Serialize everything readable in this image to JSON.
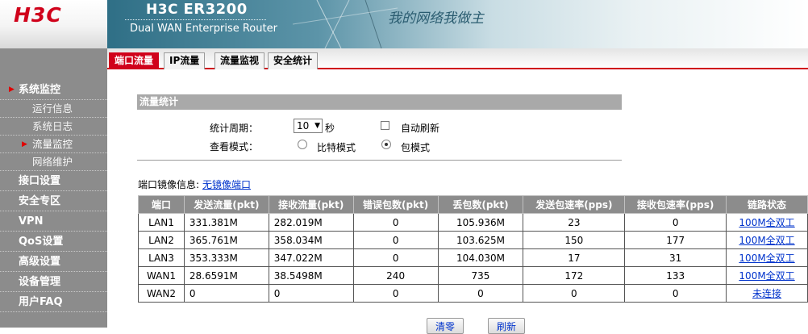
{
  "logo": "H3C",
  "banner": {
    "brand": "H3C",
    "model": "ER3200",
    "subtitle": "Dual WAN Enterprise Router",
    "slogan": "我的网络我做主"
  },
  "tabs": [
    {
      "label": "端口流量",
      "active": true
    },
    {
      "label": "IP流量",
      "active": false
    },
    {
      "label": "流量监视",
      "active": false
    },
    {
      "label": "安全统计",
      "active": false
    }
  ],
  "nav": {
    "groups": [
      {
        "label": "系统监控",
        "open": true,
        "items": [
          {
            "label": "运行信息",
            "active": false
          },
          {
            "label": "系统日志",
            "active": false
          },
          {
            "label": "流量监控",
            "active": true
          },
          {
            "label": "网络维护",
            "active": false
          }
        ]
      },
      {
        "label": "接口设置",
        "open": false,
        "items": []
      },
      {
        "label": "安全专区",
        "open": false,
        "items": []
      },
      {
        "label": "VPN",
        "open": false,
        "items": []
      },
      {
        "label": "QoS设置",
        "open": false,
        "items": []
      },
      {
        "label": "高级设置",
        "open": false,
        "items": []
      },
      {
        "label": "设备管理",
        "open": false,
        "items": []
      },
      {
        "label": "用户FAQ",
        "open": false,
        "items": []
      }
    ]
  },
  "stats": {
    "section_title": "流量统计",
    "period_label": "统计周期：",
    "period_value": "10",
    "period_unit": "秒",
    "auto_refresh_label": "自动刷新",
    "auto_refresh_checked": false,
    "view_mode_label": "查看模式：",
    "mode_bit_label": "比特模式",
    "mode_packet_label": "包模式",
    "selected_mode": "packet"
  },
  "mirror": {
    "label": "端口镜像信息:",
    "link": "无镜像端口"
  },
  "table": {
    "headers": [
      "端口",
      "发送流量(pkt)",
      "接收流量(pkt)",
      "错误包数(pkt)",
      "丢包数(pkt)",
      "发送包速率(pps)",
      "接收包速率(pps)",
      "链路状态"
    ],
    "rows": [
      [
        "LAN1",
        "331.381M",
        "282.019M",
        "0",
        "105.936M",
        "23",
        "0",
        "100M全双工"
      ],
      [
        "LAN2",
        "365.761M",
        "358.034M",
        "0",
        "103.625M",
        "150",
        "177",
        "100M全双工"
      ],
      [
        "LAN3",
        "353.333M",
        "347.022M",
        "0",
        "104.030M",
        "17",
        "31",
        "100M全双工"
      ],
      [
        "WAN1",
        "28.6591M",
        "38.5498M",
        "240",
        "735",
        "172",
        "133",
        "100M全双工"
      ],
      [
        "WAN2",
        "0",
        "0",
        "0",
        "0",
        "0",
        "0",
        "未连接"
      ]
    ]
  },
  "buttons": {
    "clear": "清零",
    "refresh": "刷新"
  }
}
